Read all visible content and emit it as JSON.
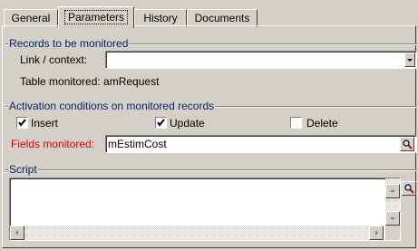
{
  "tabs": [
    "General",
    "Parameters",
    "History",
    "Documents"
  ],
  "records_group": {
    "title": "Records to be monitored",
    "link_label": "Link / context:",
    "link_value": "",
    "table_monitored": "Table monitored: amRequest"
  },
  "activation_group": {
    "title": "Activation conditions on monitored records",
    "insert_label": "Insert",
    "insert_checked": true,
    "update_label": "Update",
    "update_checked": true,
    "delete_label": "Delete",
    "delete_checked": false,
    "fields_label": "Fields monitored:",
    "fields_value": "mEstimCost"
  },
  "script_group": {
    "title": "Script",
    "script_text": ""
  },
  "colors": {
    "window_bg": "#d4d0c8",
    "group_title": "#0a246a",
    "required_label": "#e00000"
  },
  "icons": {
    "dropdown": "chevron-down-icon",
    "search": "magnifier-icon",
    "scroll_up": "arrow-up-icon",
    "scroll_down": "arrow-down-icon",
    "scroll_left": "arrow-left-icon",
    "scroll_right": "arrow-right-icon"
  }
}
